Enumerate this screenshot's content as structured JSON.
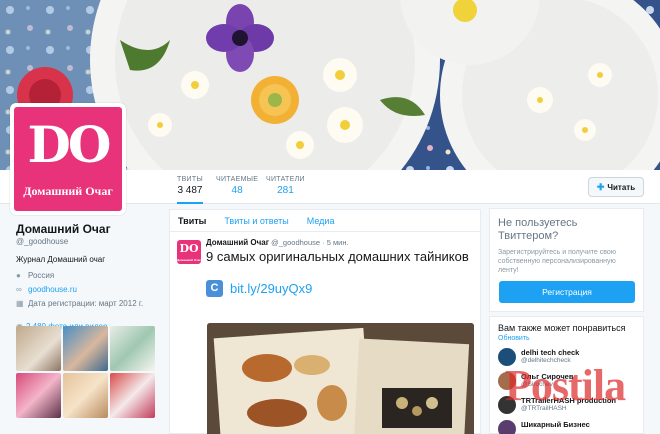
{
  "profile": {
    "name": "Домашний Очаг",
    "handle": "@_goodhouse",
    "bio": "Журнал Домашний очаг",
    "location": "Россия",
    "website": "goodhouse.ru",
    "joined": "Дата регистрации: март 2012 г.",
    "photos_link": "2 480 фото или видео",
    "avatar_big": "DO",
    "avatar_small": "Домашний Очаг"
  },
  "nav": {
    "stats": [
      {
        "label": "ТВИТЫ",
        "value": "3 487"
      },
      {
        "label": "ЧИТАЕМЫЕ",
        "value": "48"
      },
      {
        "label": "ЧИТАТЕЛИ",
        "value": "281"
      }
    ],
    "follow_label": "Читать"
  },
  "timeline": {
    "tabs": [
      "Твиты",
      "Твиты и ответы",
      "Медиа"
    ],
    "tweet": {
      "author": "Домашний Очаг",
      "handle": "@_goodhouse",
      "time": "· 5 мин.",
      "text": "9 самых оригинальных домашних тайников",
      "link": "bit.ly/29uyQx9"
    }
  },
  "signup": {
    "title": "Не пользуетесь Твиттером?",
    "text": "Зарегистрируйтесь и получите свою собственную персонализированную ленту!",
    "button": "Регистрация"
  },
  "wtf": {
    "title": "Вам также может понравиться",
    "refresh": "Обновить",
    "items": [
      {
        "name": "delhi tech check",
        "handle": "@delhitechcheck"
      },
      {
        "name": "Ольг Сирочев",
        "handle": "@Sirochev"
      },
      {
        "name": "TRTrailerHASH production",
        "handle": "@TRTrailHASH"
      },
      {
        "name": "Шикарный Бизнес",
        "handle": ""
      }
    ]
  },
  "watermark": "Postila"
}
